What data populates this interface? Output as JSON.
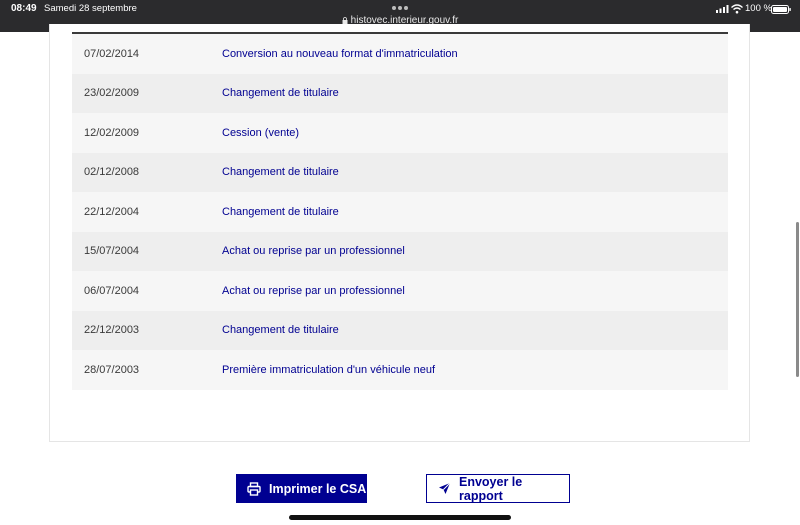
{
  "status_bar": {
    "time": "08:49",
    "date": "Samedi 28 septembre",
    "url": "histovec.interieur.gouv.fr",
    "battery": "100 %"
  },
  "history": {
    "rows": [
      {
        "date": "07/02/2014",
        "operation": "Conversion au nouveau format d'immatriculation"
      },
      {
        "date": "23/02/2009",
        "operation": "Changement de titulaire"
      },
      {
        "date": "12/02/2009",
        "operation": "Cession (vente)"
      },
      {
        "date": "02/12/2008",
        "operation": "Changement de titulaire"
      },
      {
        "date": "22/12/2004",
        "operation": "Changement de titulaire"
      },
      {
        "date": "15/07/2004",
        "operation": "Achat ou reprise par un professionnel"
      },
      {
        "date": "06/07/2004",
        "operation": "Achat ou reprise par un professionnel"
      },
      {
        "date": "22/12/2003",
        "operation": "Changement de titulaire"
      },
      {
        "date": "28/07/2003",
        "operation": "Première immatriculation d'un véhicule neuf"
      }
    ]
  },
  "actions": {
    "print_label": "Imprimer le CSA",
    "send_label": "Envoyer le rapport"
  },
  "colors": {
    "accent": "#000091",
    "row_light": "#f6f6f6",
    "row_dark": "#eeeeee",
    "status_bar": "#2b2b2d"
  },
  "icons": {
    "print": "printer-icon",
    "send": "paper-plane-icon",
    "lock": "lock-icon",
    "signal": "signal-icon",
    "wifi": "wifi-icon",
    "battery": "battery-icon"
  }
}
